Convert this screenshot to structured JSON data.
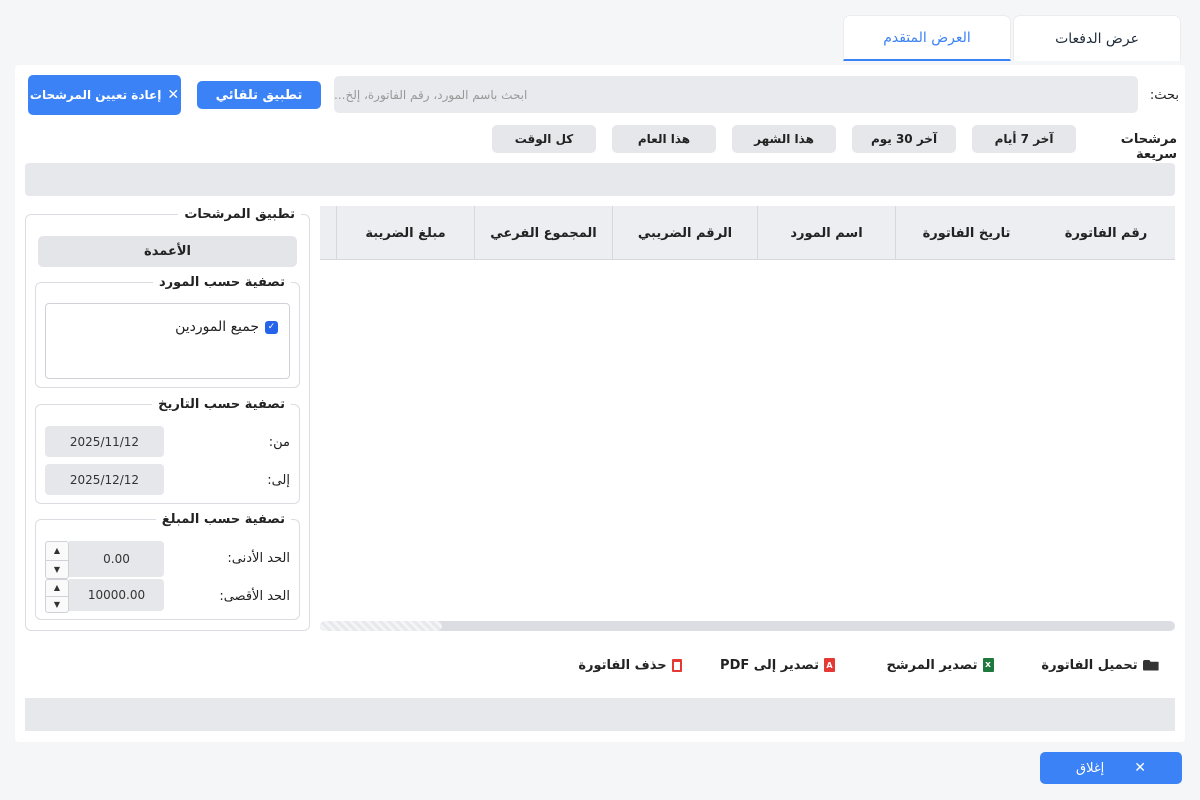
{
  "tabs": [
    {
      "label": "عرض الدفعات"
    },
    {
      "label": "العرض المتقدم"
    }
  ],
  "search": {
    "label": "بحث:",
    "placeholder": "ابحث باسم المورد، رقم الفاتورة، إلخ..."
  },
  "buttons": {
    "auto_apply": "تطبيق تلقائي",
    "reset_filters": "إعادة تعيين المرشحات",
    "close": "إغلاق"
  },
  "quick_filters": {
    "label": "مرشحات سريعة",
    "items": [
      "آخر 7 أيام",
      "آخر 30 يوم",
      "هذا الشهر",
      "هذا العام",
      "كل الوقت"
    ]
  },
  "table": {
    "columns": [
      "رقم الفاتورة",
      "تاريخ الفاتورة",
      "اسم المورد",
      "الرقم الضريبي",
      "المجموع الفرعي",
      "مبلغ الضريبة"
    ]
  },
  "filters_panel": {
    "title": "تطبيق المرشحات",
    "columns_button": "الأعمدة",
    "supplier": {
      "title": "تصفية حسب المورد",
      "all_label": "جميع الموردين"
    },
    "date": {
      "title": "تصفية حسب التاريخ",
      "from_label": "من:",
      "from_value": "2025/11/12",
      "to_label": "إلى:",
      "to_value": "2025/12/12"
    },
    "amount": {
      "title": "تصفية حسب المبلغ",
      "min_label": "الحد الأدنى:",
      "min_value": "0.00",
      "max_label": "الحد الأقصى:",
      "max_value": "10000.00"
    }
  },
  "actions": {
    "load_invoice": "تحميل الفاتورة",
    "export_filtered": "تصدير المرشح",
    "export_pdf": "تصدير إلى PDF",
    "delete_invoice": "حذف الفاتورة"
  },
  "colors": {
    "accent": "#3b82f6",
    "excel": "#1d7a3c",
    "pdf": "#e53935",
    "delete": "#e53935"
  }
}
